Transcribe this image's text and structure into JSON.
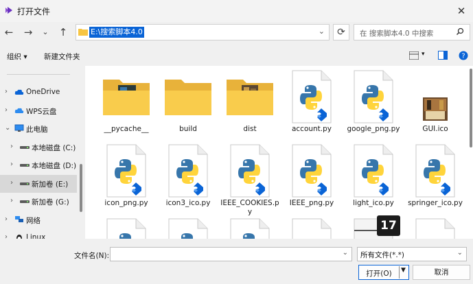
{
  "window": {
    "title": "打开文件",
    "close": "✕"
  },
  "address": {
    "path": "E:\\搜索脚本4.0"
  },
  "search": {
    "placeholder": "在 搜索脚本4.0 中搜索"
  },
  "toolbar": {
    "organize": "组织 ▾",
    "new_folder": "新建文件夹",
    "view_label": "▾"
  },
  "sidebar": {
    "items": [
      {
        "label": "OneDrive",
        "arrow": "›",
        "icon": "cloud-icon"
      },
      {
        "label": "WPS云盘",
        "arrow": "›",
        "icon": "cloud-icon"
      },
      {
        "label": "此电脑",
        "arrow": "⌄",
        "icon": "computer-icon"
      },
      {
        "label": "本地磁盘 (C:)",
        "arrow": "›",
        "icon": "drive-icon"
      },
      {
        "label": "本地磁盘 (D:)",
        "arrow": "›",
        "icon": "drive-icon"
      },
      {
        "label": "新加卷 (E:)",
        "arrow": "›",
        "icon": "drive-icon"
      },
      {
        "label": "新加卷 (G:)",
        "arrow": "›",
        "icon": "drive-icon"
      },
      {
        "label": "网络",
        "arrow": "›",
        "icon": "network-icon"
      },
      {
        "label": "Linux",
        "arrow": "›",
        "icon": "linux-icon"
      }
    ]
  },
  "files": [
    {
      "name": "__pycache__",
      "kind": "folder-pycache"
    },
    {
      "name": "build",
      "kind": "folder"
    },
    {
      "name": "dist",
      "kind": "folder-dist"
    },
    {
      "name": "account.py",
      "kind": "python"
    },
    {
      "name": "google_png.py",
      "kind": "python"
    },
    {
      "name": "GUI.ico",
      "kind": "image"
    },
    {
      "name": "icon_png.py",
      "kind": "python"
    },
    {
      "name": "icon3_ico.py",
      "kind": "python"
    },
    {
      "name": "IEEE_COOKIES.py",
      "kind": "python"
    },
    {
      "name": "IEEE_png.py",
      "kind": "python"
    },
    {
      "name": "light_ico.py",
      "kind": "python"
    },
    {
      "name": "springer_ico.py",
      "kind": "python"
    },
    {
      "name": "",
      "kind": "python"
    },
    {
      "name": "",
      "kind": "python"
    },
    {
      "name": "",
      "kind": "python"
    },
    {
      "name": "",
      "kind": "blank"
    },
    {
      "name": "",
      "kind": "blank-dark"
    },
    {
      "name": "",
      "kind": "blank"
    }
  ],
  "bottom": {
    "filename_label": "文件名(N):",
    "filename_value": "",
    "filetype": "所有文件(*.*)",
    "open": "打开(O)",
    "cancel": "取消"
  },
  "overlay_badge": "17",
  "colors": {
    "accent": "#0a64d6",
    "folder": "#f7c542",
    "python_blue": "#3776ab",
    "python_yellow": "#ffd43b"
  }
}
